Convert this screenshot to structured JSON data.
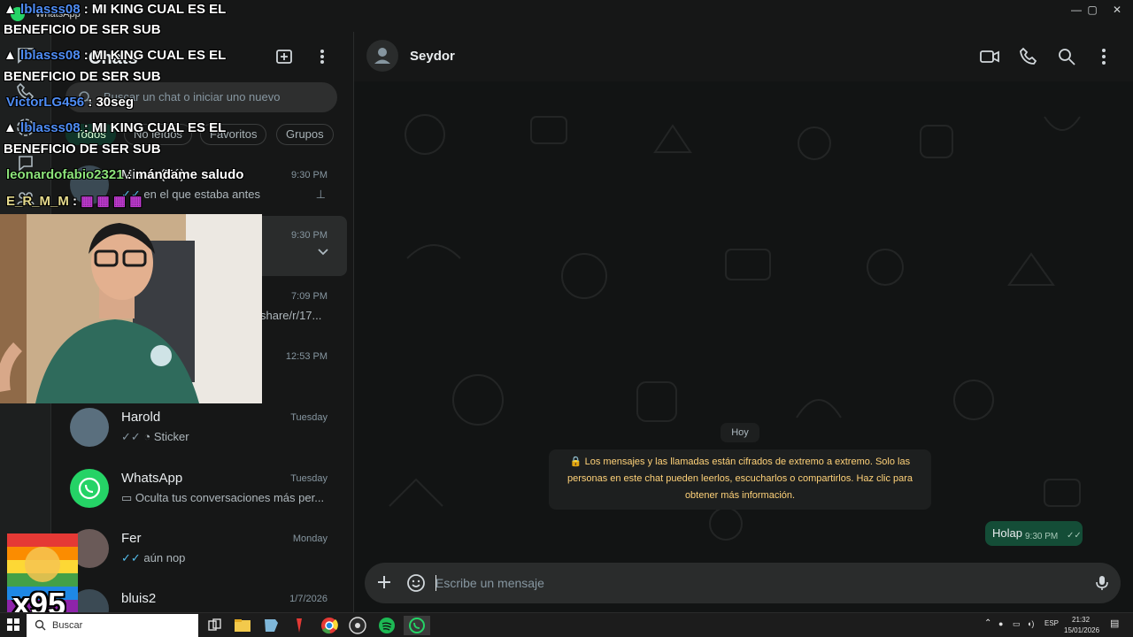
{
  "window": {
    "title": "WhatsApp",
    "controls": [
      "—",
      "▢",
      "✕"
    ]
  },
  "sidebar": {
    "title": "Chats",
    "search_placeholder": "Buscar un chat o iniciar uno nuevo",
    "filters": [
      "Todos",
      "No leídos",
      "Favoritos",
      "Grupos"
    ],
    "chats": [
      {
        "name": "Mis ... (Tú)",
        "time": "9:30 PM",
        "preview": "en el que estaba antes",
        "pinned": true
      },
      {
        "name": "",
        "time": "9:30 PM",
        "preview": "",
        "hover": true
      },
      {
        "name": "",
        "time": "7:09 PM",
        "preview": "share/r/17..."
      },
      {
        "name": "",
        "time": "12:53 PM",
        "preview": ""
      },
      {
        "name": "Harold",
        "time": "Tuesday",
        "preview": "Sticker"
      },
      {
        "name": "WhatsApp",
        "time": "Tuesday",
        "preview": "Oculta tus conversaciones más per..."
      },
      {
        "name": "Fer",
        "time": "Monday",
        "preview": "aún nop"
      },
      {
        "name": "bluis2",
        "time": "1/7/2026",
        "preview": ""
      }
    ]
  },
  "chat": {
    "contact_name": "Seydor",
    "date_chip": "Hoy",
    "encryption_notice": "🔒 Los mensajes y las llamadas están cifrados de extremo a extremo. Solo las personas en este chat pueden leerlos, escucharlos o compartirlos. Haz clic para obtener más información.",
    "messages": [
      {
        "text": "Holap",
        "time": "9:30 PM",
        "outgoing": true
      }
    ],
    "composer_placeholder": "Escribe un mensaje"
  },
  "stream_overlay": {
    "chat_lines": [
      {
        "user": "lblasss08",
        "text": ": MI KING CUAL ES EL",
        "cont": "BENEFICIO DE SER SUB"
      },
      {
        "user": "lblasss08",
        "text": ": MI KING CUAL ES EL",
        "cont": "BENEFICIO DE SER SUB"
      },
      {
        "user": "VictorLG456",
        "text": ": 30seg"
      },
      {
        "user": "lblasss08",
        "text": ": MI KING CUAL ES EL",
        "cont": "BENEFICIO DE SER SUB"
      },
      {
        "user": "leonardofabio2321",
        "text": ": mándame saludo"
      },
      {
        "user": "E_R_M_M",
        "text": ":"
      }
    ],
    "sticker_count": "x95"
  },
  "taskbar": {
    "search_placeholder": "Buscar",
    "tray_lang": "ESP",
    "tray_time": "21:32",
    "tray_date": "15/01/2026"
  },
  "colors": {
    "accent": "#25d366",
    "outgoing_bubble": "#144d37",
    "notice_text": "#ffd279",
    "link_tick": "#53bdeb"
  }
}
